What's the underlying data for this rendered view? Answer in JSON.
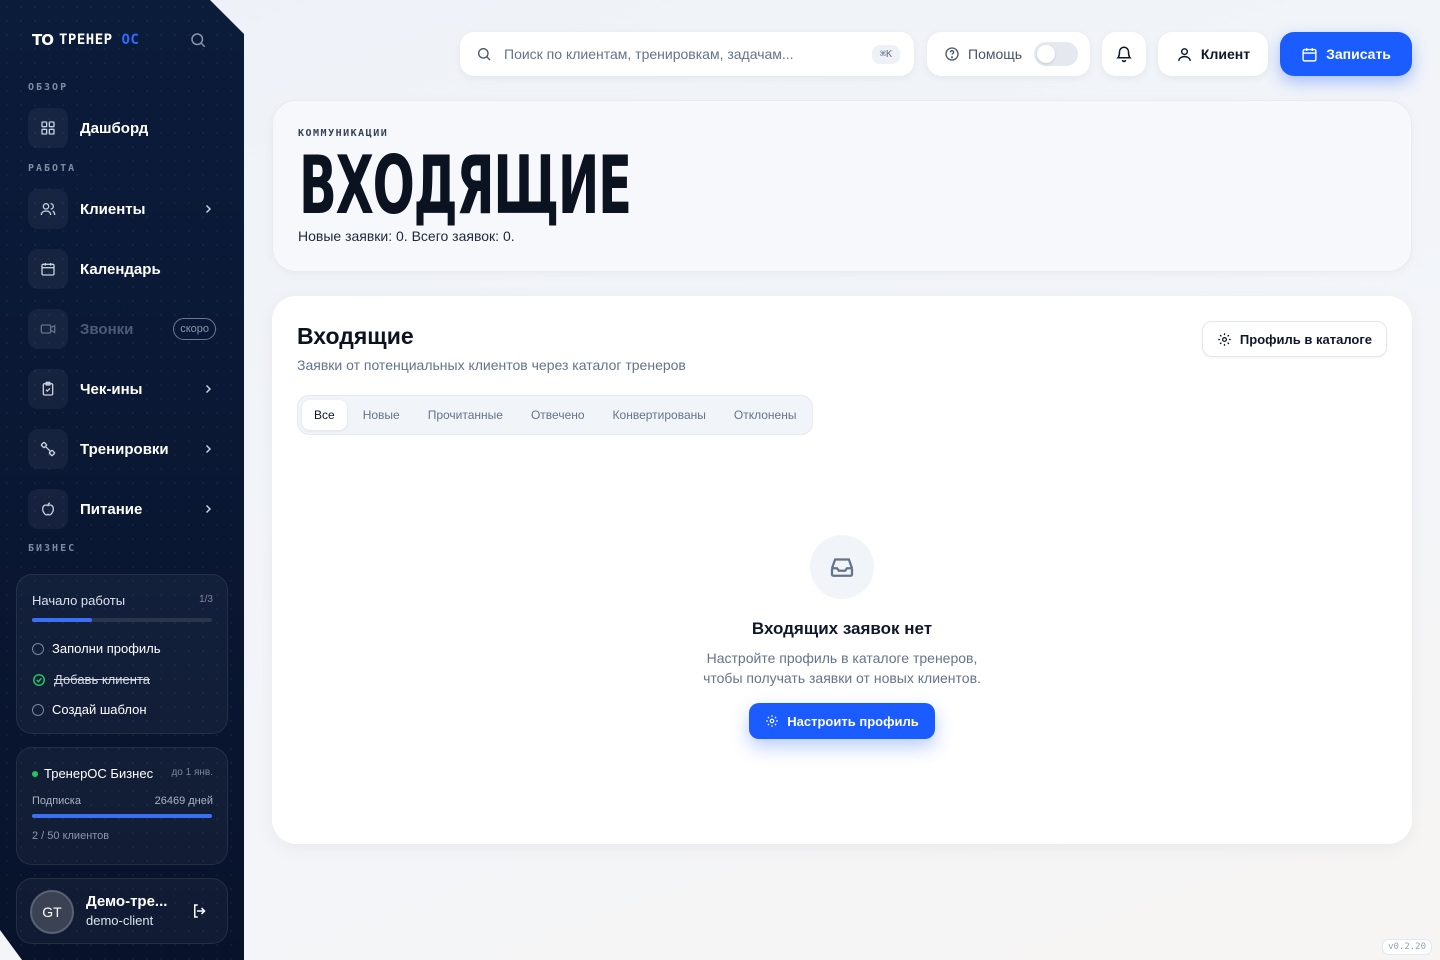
{
  "brand": {
    "mark": "TO",
    "name": "ТРЕНЕР",
    "suffix": "ОС"
  },
  "sidebar": {
    "sections": {
      "overview": "ОБЗОР",
      "work": "РАБОТА",
      "business": "БИЗНЕС"
    },
    "items": [
      {
        "label": "Дашборд",
        "icon": "dashboard-icon"
      },
      {
        "label": "Клиенты",
        "icon": "users-icon"
      },
      {
        "label": "Календарь",
        "icon": "calendar-icon"
      },
      {
        "label": "Звонки",
        "icon": "video-icon",
        "badge": "скоро"
      },
      {
        "label": "Чек-ины",
        "icon": "clipboard-icon"
      },
      {
        "label": "Тренировки",
        "icon": "dumbbell-icon"
      },
      {
        "label": "Питание",
        "icon": "apple-icon"
      }
    ],
    "onboarding": {
      "title": "Начало работы",
      "count": "1/3",
      "progress": 0.333,
      "tasks": [
        {
          "label": "Заполни профиль",
          "done": false
        },
        {
          "label": "Добавь клиента",
          "done": true
        },
        {
          "label": "Создай шаблон",
          "done": false
        }
      ]
    },
    "business": {
      "plan": "ТренерОС Бизнес",
      "until": "до 1 янв.",
      "subscription_label": "Подписка",
      "days": "26469 дней",
      "clients": "2 / 50 клиентов"
    },
    "user": {
      "initials": "GT",
      "name": "Демо-тре...",
      "login": "demo-client"
    }
  },
  "topbar": {
    "search_placeholder": "Поиск по клиентам, тренировкам, задачам...",
    "search_shortcut": "⌘K",
    "help_label": "Помощь",
    "client_label": "Клиент",
    "book_label": "Записать"
  },
  "hero": {
    "eyebrow": "КОММУНИКАЦИИ",
    "title": "ВХОДЯЩИЕ",
    "subtitle": "Новые заявки: 0. Всего заявок: 0."
  },
  "panel": {
    "title": "Входящие",
    "subtitle": "Заявки от потенциальных клиентов через каталог тренеров",
    "catalog_button": "Профиль в каталоге",
    "tabs": [
      "Все",
      "Новые",
      "Прочитанные",
      "Отвечено",
      "Конвертированы",
      "Отклонены"
    ],
    "active_tab": "Все",
    "empty": {
      "title": "Входящих заявок нет",
      "line1": "Настройте профиль в каталоге тренеров,",
      "line2": "чтобы получать заявки от новых клиентов.",
      "button": "Настроить профиль"
    }
  },
  "version": "v0.2.20",
  "colors": {
    "accent": "#1a5cff",
    "sidebar_bg": "#0b1b3a",
    "success": "#22c55e"
  }
}
